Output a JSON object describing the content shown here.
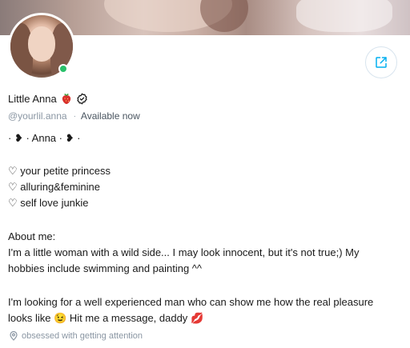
{
  "profile": {
    "name": "Little Anna",
    "name_emoji_icon": "strawberry-icon",
    "verified_icon": "verified-badge-icon",
    "handle": "@yourlil.anna",
    "separator": "·",
    "availability": "Available now",
    "online_color": "#29c06a"
  },
  "actions": {
    "share_icon": "share-icon",
    "accent_color": "#00aff0"
  },
  "bio": {
    "line1": "· ❥ · Anna  · ❥ ·",
    "line2": "♡ your petite princess",
    "line3": "♡ alluring&feminine",
    "line4": "♡ self love junkie",
    "line5": "About me:",
    "line6": "I'm a little woman with a wild side... I may look innocent, but it's not true;) My",
    "line7": "hobbies include swimming and painting ^^",
    "line8": "I'm looking for a well experienced man who can show me how the real pleasure",
    "line9_a": "looks like",
    "line9_emoji1": "😉",
    "line9_b": "Hit me a message, daddy",
    "line9_emoji2": "💋"
  },
  "location": {
    "icon": "location-pin-icon",
    "text": "obsessed with getting attention"
  }
}
